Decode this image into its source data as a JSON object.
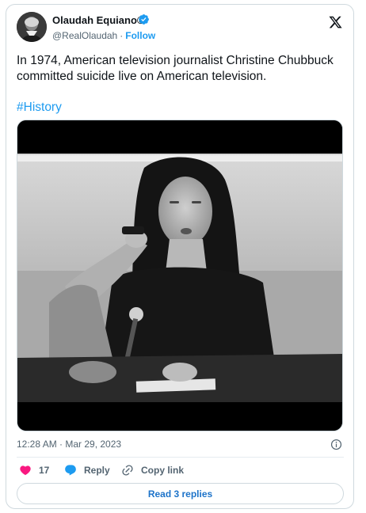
{
  "author": {
    "name": "Olaudah Equiano®",
    "handle": "@RealOlaudah",
    "separator": "·",
    "follow_label": "Follow",
    "verified": true
  },
  "tweet": {
    "text": "In 1974, American television journalist Christine Chubbuck committed suicide live on American television.",
    "hashtag": "#History",
    "timestamp": "12:28 AM · Mar 29, 2023"
  },
  "actions": {
    "likes": "17",
    "reply_label": "Reply",
    "copy_link_label": "Copy link",
    "read_replies_label": "Read 3 replies"
  },
  "icons": {
    "verified": "verified-badge-icon",
    "brand": "x-logo-icon",
    "info": "info-icon",
    "like": "heart-icon",
    "reply": "reply-bubble-icon",
    "copy": "link-icon"
  },
  "colors": {
    "accent": "#1d9bf0",
    "like": "#f91880",
    "muted": "#536471",
    "border": "#cfd9de"
  }
}
